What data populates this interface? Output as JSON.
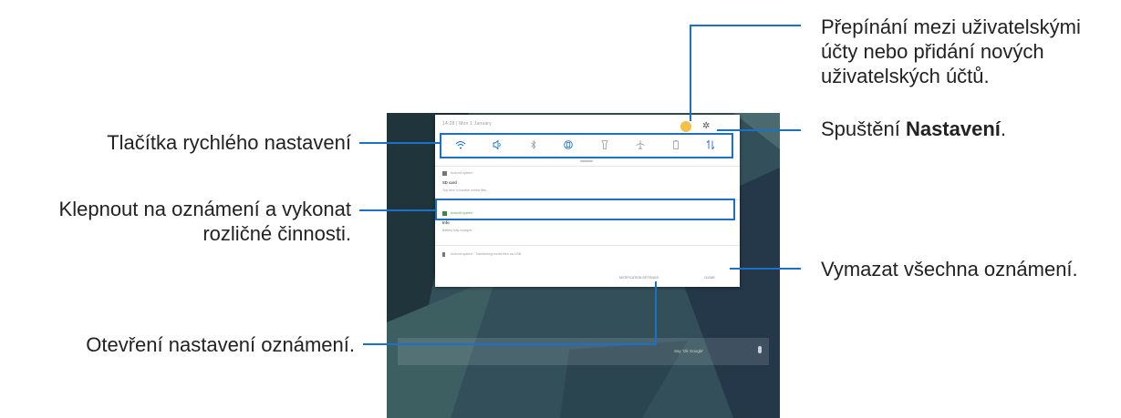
{
  "device": {
    "datetime": "14:28 | Mon 1 January",
    "quick_settings": [
      {
        "icon": "wifi-icon",
        "glyph": "ᯤ"
      },
      {
        "icon": "sound-icon",
        "glyph": "🔈"
      },
      {
        "icon": "bluetooth-icon",
        "glyph": "ᛒ"
      },
      {
        "icon": "auto-rotate-icon",
        "glyph": "⟳"
      },
      {
        "icon": "flashlight-icon",
        "glyph": "♆"
      },
      {
        "icon": "airplane-mode-icon",
        "glyph": "✈"
      },
      {
        "icon": "power-saving-icon",
        "glyph": "▯"
      },
      {
        "icon": "mobile-data-icon",
        "glyph": "⇅"
      }
    ],
    "notifications": [
      {
        "app": "Android system",
        "title": "SD card",
        "text": "Tap here to transfer media files."
      },
      {
        "app": "Android system",
        "title": "Info",
        "text": "Battery fully charged."
      },
      {
        "app": "Android system · Transferring media files via USB"
      }
    ],
    "notification_settings_label": "NOTIFICATION SETTINGS",
    "clear_label": "CLEAR",
    "search_hint": "Say 'Ok Google'"
  },
  "callouts": {
    "account_switch": [
      "Přepínání mezi uživatelskými",
      "účty nebo přidání nových",
      "uživatelských účtů."
    ],
    "settings_prefix": "Spuštění ",
    "settings_bold": "Nastavení",
    "settings_suffix": ".",
    "quick_settings": "Tlačítka rychlého nastavení",
    "tap_notification": [
      "Klepnout na oznámení a vykonat",
      "rozličné činnosti."
    ],
    "clear_all": "Vymazat všechna oznámení.",
    "open_notification_settings": "Otevření nastavení oznámení."
  },
  "colors": {
    "accent": "#1b70c8",
    "avatar": "#f3c04a",
    "notification_green": "#4caf50"
  }
}
